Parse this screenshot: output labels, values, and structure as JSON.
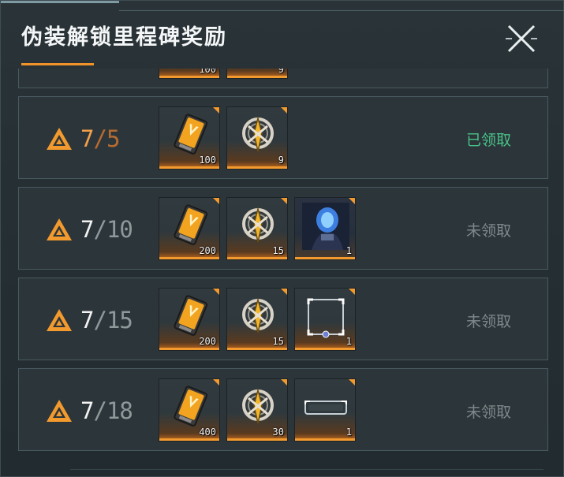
{
  "header": {
    "title": "伪装解锁里程碑奖励",
    "close_icon": "close-x-icon"
  },
  "colors": {
    "accent_orange": "#f0932b",
    "claimed_green": "#49c38a",
    "unclaimed_gray": "#7f898c"
  },
  "partial_row": {
    "items": [
      {
        "icon": "gold-card-icon",
        "qty": "100"
      },
      {
        "icon": "crossed-swords-emblem-icon",
        "qty": "9"
      }
    ]
  },
  "rows": [
    {
      "current": "7",
      "slash": "/",
      "target": "5",
      "status": "已领取",
      "claimed": true,
      "items": [
        {
          "icon": "gold-card-icon",
          "qty": "100"
        },
        {
          "icon": "crossed-swords-emblem-icon",
          "qty": "9"
        }
      ]
    },
    {
      "current": "7",
      "slash": "/",
      "target": "10",
      "status": "未领取",
      "claimed": false,
      "items": [
        {
          "icon": "gold-card-icon",
          "qty": "200"
        },
        {
          "icon": "crossed-swords-emblem-icon",
          "qty": "15"
        },
        {
          "icon": "character-portrait-icon",
          "qty": "1"
        }
      ]
    },
    {
      "current": "7",
      "slash": "/",
      "target": "15",
      "status": "未领取",
      "claimed": false,
      "items": [
        {
          "icon": "gold-card-icon",
          "qty": "200"
        },
        {
          "icon": "crossed-swords-emblem-icon",
          "qty": "15"
        },
        {
          "icon": "avatar-frame-icon",
          "qty": "1"
        }
      ]
    },
    {
      "current": "7",
      "slash": "/",
      "target": "18",
      "status": "未领取",
      "claimed": false,
      "items": [
        {
          "icon": "gold-card-icon",
          "qty": "400"
        },
        {
          "icon": "crossed-swords-emblem-icon",
          "qty": "30"
        },
        {
          "icon": "name-plate-frame-icon",
          "qty": "1"
        }
      ]
    }
  ]
}
